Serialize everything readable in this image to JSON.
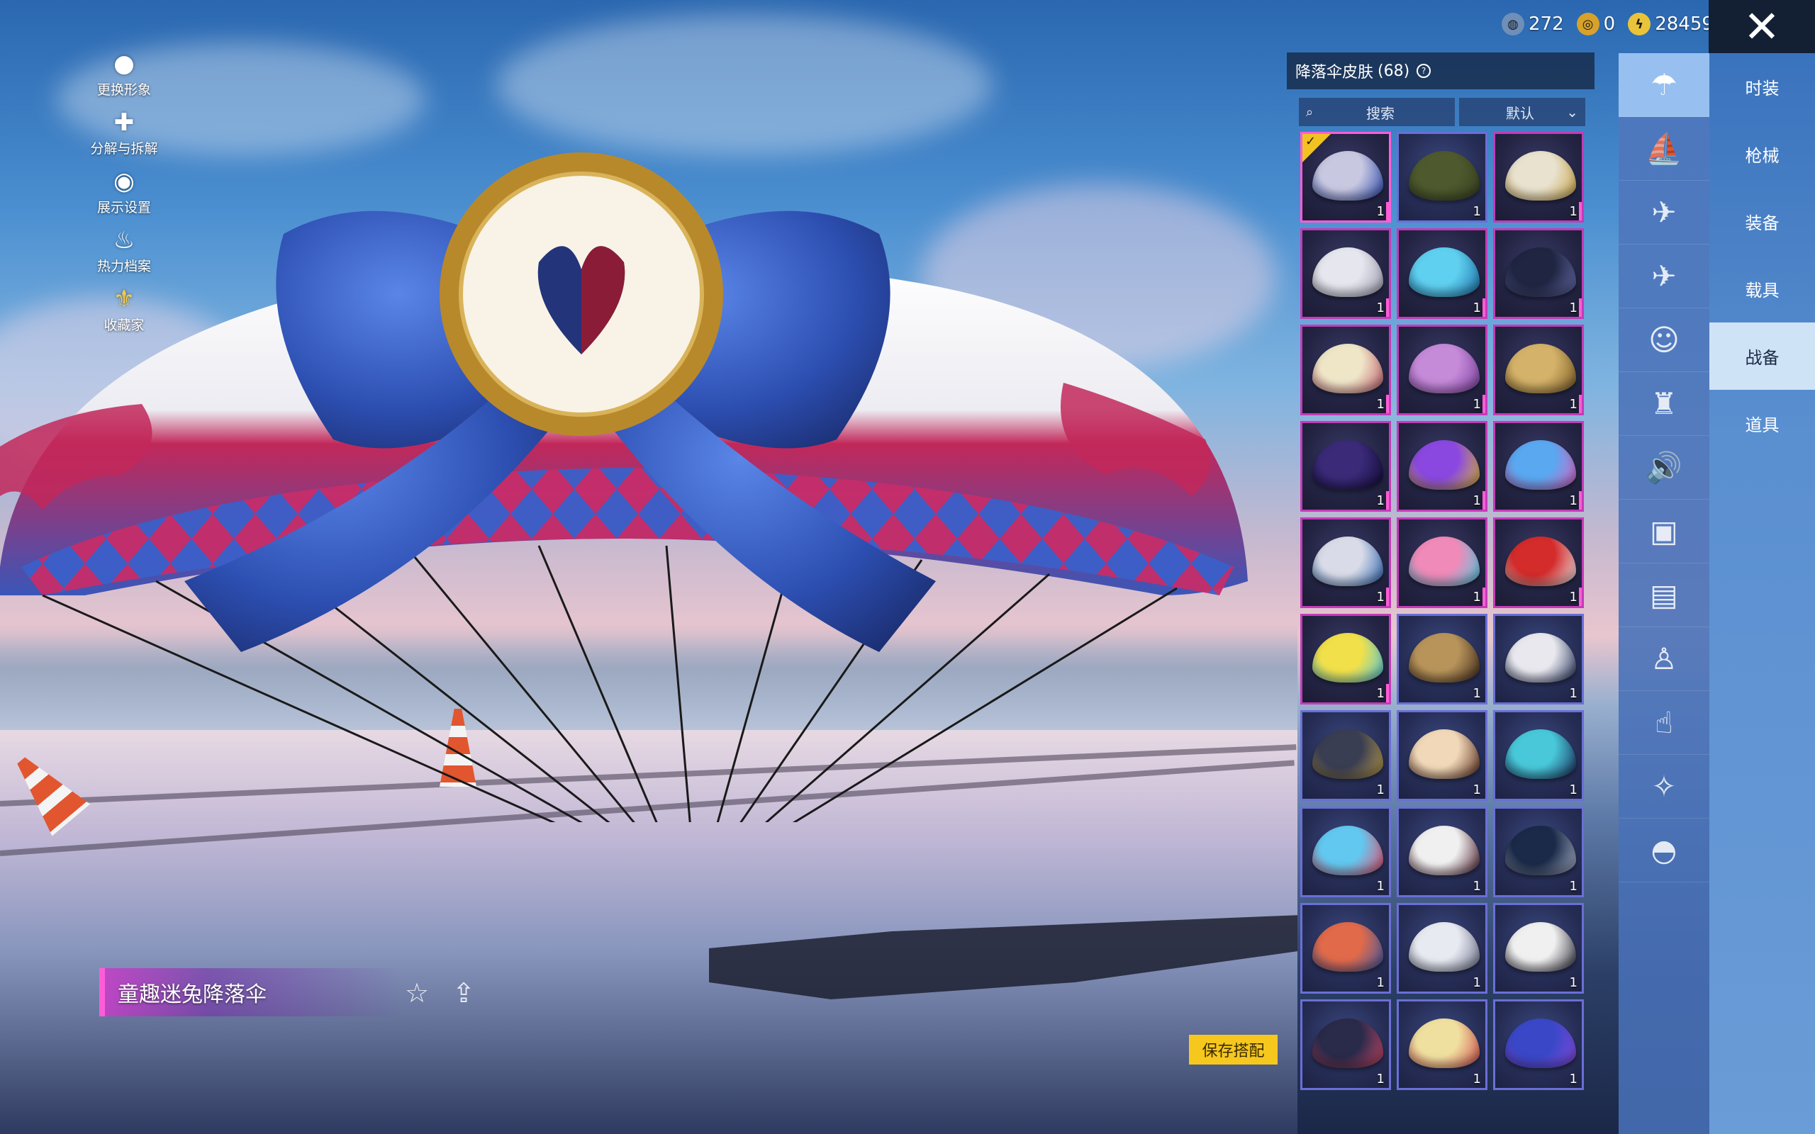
{
  "currency": [
    {
      "icon": "globe-coin-icon",
      "value": "272",
      "color": "#6e8fb8"
    },
    {
      "icon": "gold-token-icon",
      "value": "0",
      "color": "#d7a12a"
    },
    {
      "icon": "lightning-coin-icon",
      "value": "28459",
      "color": "#e9c43a"
    }
  ],
  "left_menu": [
    {
      "icon": "avatar-icon",
      "glyph": "●",
      "label": "更换形象"
    },
    {
      "icon": "puzzle-icon",
      "glyph": "✚",
      "label": "分解与拆解"
    },
    {
      "icon": "eye-icon",
      "glyph": "◉",
      "label": "展示设置"
    },
    {
      "icon": "flame-icon",
      "glyph": "♨",
      "label": "热力档案"
    },
    {
      "icon": "collector-icon",
      "glyph": "⚜",
      "label": "收藏家"
    }
  ],
  "item": {
    "name": "童趣迷兔降落伞"
  },
  "save_label": "保存搭配",
  "panel": {
    "title": "降落伞皮肤",
    "count": "(68)",
    "search_label": "搜索",
    "sort_label": "默认"
  },
  "skins": [
    {
      "q": "1",
      "rarity": "legend",
      "selected": true,
      "c1": "#c8c8e0",
      "c2": "#2a47b0"
    },
    {
      "q": "1",
      "rarity": "epic",
      "c1": "#4e5a2e",
      "c2": "#3a4221"
    },
    {
      "q": "1",
      "rarity": "legend",
      "c1": "#e8e2cf",
      "c2": "#c9a040"
    },
    {
      "q": "1",
      "rarity": "legend",
      "c1": "#e6e6ee",
      "c2": "#9a9ab0"
    },
    {
      "q": "1",
      "rarity": "legend",
      "c1": "#5fd0ef",
      "c2": "#1b6ea8"
    },
    {
      "q": "1",
      "rarity": "legend",
      "c1": "#202642",
      "c2": "#6a6fb0"
    },
    {
      "q": "1",
      "rarity": "legend",
      "c1": "#efe6c8",
      "c2": "#c05a6a"
    },
    {
      "q": "1",
      "rarity": "legend",
      "c1": "#c58ad8",
      "c2": "#7b3fa0"
    },
    {
      "q": "1",
      "rarity": "legend",
      "c1": "#d4b26a",
      "c2": "#7a5a22"
    },
    {
      "q": "1",
      "rarity": "legend",
      "c1": "#3a2a78",
      "c2": "#140c38"
    },
    {
      "q": "1",
      "rarity": "legend",
      "c1": "#8a48e0",
      "c2": "#e0c030"
    },
    {
      "q": "1",
      "rarity": "legend",
      "c1": "#5aa8f0",
      "c2": "#e060c0"
    },
    {
      "q": "1",
      "rarity": "legend",
      "c1": "#d9dbe8",
      "c2": "#2a63b0"
    },
    {
      "q": "1",
      "rarity": "legend",
      "c1": "#f08ab8",
      "c2": "#4bd0e8"
    },
    {
      "q": "1",
      "rarity": "legend",
      "c1": "#d42b2b",
      "c2": "#f0f0f0"
    },
    {
      "q": "1",
      "rarity": "legend",
      "c1": "#f2e04a",
      "c2": "#48c8e8"
    },
    {
      "q": "1",
      "rarity": "epic",
      "c1": "#b8945a",
      "c2": "#402a1c"
    },
    {
      "q": "1",
      "rarity": "epic",
      "c1": "#e8e8ee",
      "c2": "#22305a"
    },
    {
      "q": "1",
      "rarity": "epic",
      "c1": "#3a3e52",
      "c2": "#c0a04a"
    },
    {
      "q": "1",
      "rarity": "epic",
      "c1": "#f0d8b8",
      "c2": "#5a2a1a"
    },
    {
      "q": "1",
      "rarity": "epic",
      "c1": "#48c8d8",
      "c2": "#1a2a5a"
    },
    {
      "q": "1",
      "rarity": "epic",
      "c1": "#62c8f0",
      "c2": "#f04a6a"
    },
    {
      "q": "1",
      "rarity": "epic",
      "c1": "#f0f0f0",
      "c2": "#4a1a2a"
    },
    {
      "q": "1",
      "rarity": "epic",
      "c1": "#1a2a48",
      "c2": "#b0b8d0"
    },
    {
      "q": "1",
      "rarity": "epic",
      "c1": "#e06a4a",
      "c2": "#3a58a8"
    },
    {
      "q": "1",
      "rarity": "epic",
      "c1": "#e8eaf2",
      "c2": "#6a7088"
    },
    {
      "q": "1",
      "rarity": "epic",
      "c1": "#f0f0f0",
      "c2": "#2a2a38"
    },
    {
      "q": "1",
      "rarity": "epic",
      "c1": "#2a2a4a",
      "c2": "#d04a6a"
    },
    {
      "q": "1",
      "rarity": "epic",
      "c1": "#f0e0a0",
      "c2": "#d04a4a"
    },
    {
      "q": "1",
      "rarity": "epic",
      "c1": "#3a48c8",
      "c2": "#8a4ae0"
    }
  ],
  "category_icons": [
    {
      "icon": "parachute-icon",
      "glyph": "☂",
      "active": true
    },
    {
      "icon": "boat-icon",
      "glyph": "⛵"
    },
    {
      "icon": "drone-icon",
      "glyph": "✈"
    },
    {
      "icon": "plane-icon",
      "glyph": "✈"
    },
    {
      "icon": "emote-face-icon",
      "glyph": "☺"
    },
    {
      "icon": "robot-icon",
      "glyph": "♜"
    },
    {
      "icon": "speaker-icon",
      "glyph": "🔊"
    },
    {
      "icon": "sticker-icon",
      "glyph": "▣"
    },
    {
      "icon": "image-frame-icon",
      "glyph": "▤"
    },
    {
      "icon": "spray-icon",
      "glyph": "♙"
    },
    {
      "icon": "finger-tap-icon",
      "glyph": "☝"
    },
    {
      "icon": "magic-wand-icon",
      "glyph": "✧"
    },
    {
      "icon": "helmet-icon",
      "glyph": "◓"
    }
  ],
  "tabs": [
    {
      "label": "时装"
    },
    {
      "label": "枪械"
    },
    {
      "label": "装备"
    },
    {
      "label": "载具"
    },
    {
      "label": "战备",
      "active": true
    },
    {
      "label": "道具"
    }
  ]
}
